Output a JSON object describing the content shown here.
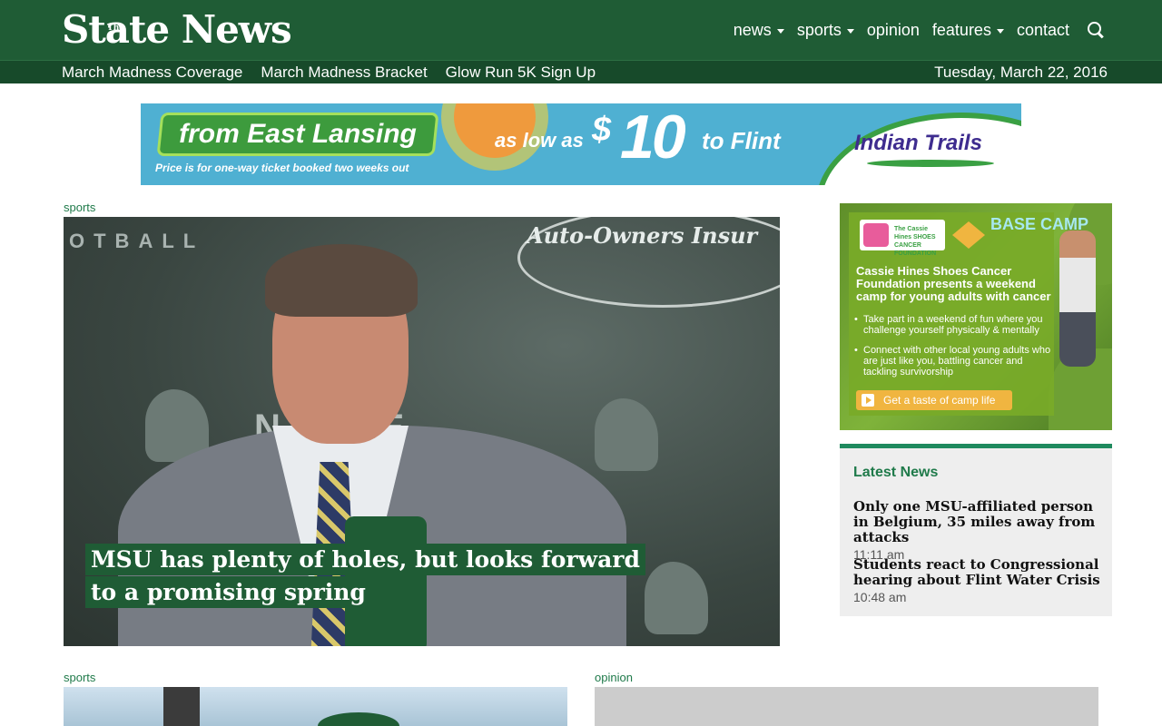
{
  "header": {
    "logo_the": "The",
    "logo": "State News",
    "nav": [
      {
        "label": "news",
        "dropdown": true
      },
      {
        "label": "sports",
        "dropdown": true
      },
      {
        "label": "opinion",
        "dropdown": false
      },
      {
        "label": "features",
        "dropdown": true
      },
      {
        "label": "contact",
        "dropdown": false
      }
    ],
    "search_icon": "search-icon",
    "quick_links": [
      "March Madness Coverage",
      "March Madness Bracket",
      "Glow Run 5K Sign Up"
    ],
    "date": "Tuesday, March 22, 2016"
  },
  "ad_top": {
    "from": "from East Lansing",
    "fine_print": "Price is for one-way ticket booked two weeks out",
    "low": "as low as",
    "dollar": "$",
    "price": "10",
    "dest": "to Flint",
    "brand": "Indian Trails"
  },
  "hero": {
    "section": "sports",
    "sponsor_text": "Auto-Owners Insur",
    "wall_text_1": "OTBALL",
    "wall_text_2": "N STATE",
    "headline": "MSU has plenty of holes, but looks forward to a promising spring"
  },
  "ad_side": {
    "foundation_logo": "The Cassie Hines SHOES CANCER FOUNDATION",
    "camp_logo": "BASE CAMP",
    "title": "Cassie Hines Shoes Cancer Foundation presents a weekend camp for young adults with cancer",
    "bullets": [
      "Take part in a weekend of fun where you challenge yourself physically & mentally",
      "Connect with other local young adults who are just like you, battling cancer and tackling survivorship"
    ],
    "cta": "Get a taste of camp life"
  },
  "latest": {
    "title": "Latest News",
    "stories": [
      {
        "title": "Only one MSU-affiliated person in Belgium, 35 miles away from attacks",
        "time": "11:11 am"
      },
      {
        "title": "Students react to Congressional hearing about Flint Water Crisis",
        "time": "10:48 am"
      }
    ]
  },
  "bottom": {
    "left_section": "sports",
    "right_section": "opinion"
  },
  "colors": {
    "brand_green": "#1f5c35",
    "subbar_green": "#174a2a",
    "accent_green": "#1f8a5e",
    "label_green": "#1f7a4a"
  }
}
